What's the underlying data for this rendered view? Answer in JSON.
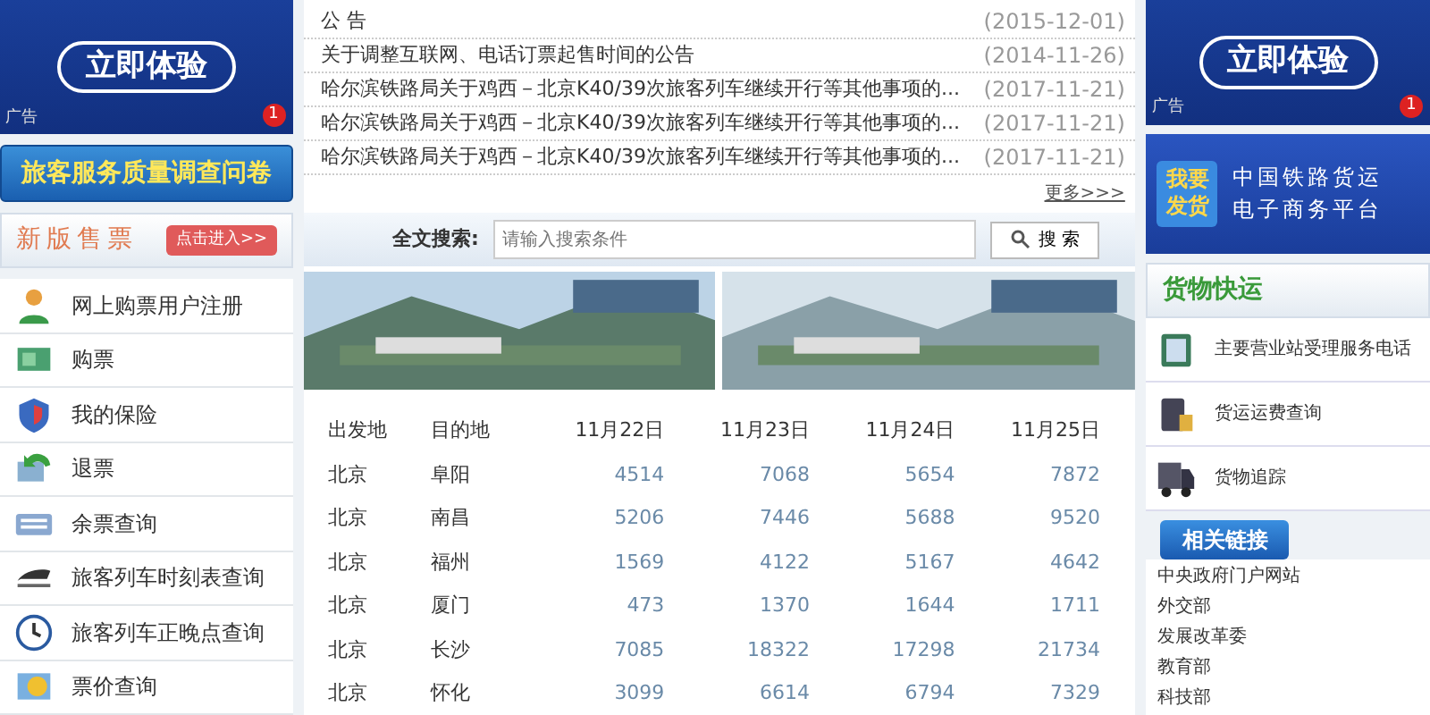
{
  "left_ad": {
    "button": "立即体验",
    "tag": "广告",
    "counter": "1"
  },
  "survey_button": "旅客服务质量调查问卷",
  "new_ticketing": {
    "title": "新版售票",
    "enter_button": "点击进入>>"
  },
  "services": [
    {
      "label": "网上购票用户注册",
      "kind": "user"
    },
    {
      "label": "购票",
      "kind": "ticket"
    },
    {
      "label": "我的保险",
      "kind": "shield"
    },
    {
      "label": "退票",
      "kind": "refund"
    },
    {
      "label": "余票查询",
      "kind": "keyboard"
    },
    {
      "label": "旅客列车时刻表查询",
      "kind": "train"
    },
    {
      "label": "旅客列车正晚点查询",
      "kind": "clock"
    },
    {
      "label": "票价查询",
      "kind": "price"
    }
  ],
  "notices": [
    {
      "title": "公 告",
      "date": "(2015-12-01)"
    },
    {
      "title": "关于调整互联网、电话订票起售时间的公告",
      "date": "(2014-11-26)"
    },
    {
      "title": "哈尔滨铁路局关于鸡西－北京K40/39次旅客列车继续开行等其他事项的...",
      "date": "(2017-11-21)"
    },
    {
      "title": "哈尔滨铁路局关于鸡西－北京K40/39次旅客列车继续开行等其他事项的...",
      "date": "(2017-11-21)"
    },
    {
      "title": "哈尔滨铁路局关于鸡西－北京K40/39次旅客列车继续开行等其他事项的...",
      "date": "(2017-11-21)"
    }
  ],
  "more_link": "更多>>>",
  "search": {
    "label": "全文搜索:",
    "placeholder": "请输入搜索条件",
    "button": "搜 索"
  },
  "table": {
    "columns": [
      "出发地",
      "目的地",
      "11月22日",
      "11月23日",
      "11月24日",
      "11月25日"
    ],
    "rows": [
      [
        "北京",
        "阜阳",
        "4514",
        "7068",
        "5654",
        "7872"
      ],
      [
        "北京",
        "南昌",
        "5206",
        "7446",
        "5688",
        "9520"
      ],
      [
        "北京",
        "福州",
        "1569",
        "4122",
        "5167",
        "4642"
      ],
      [
        "北京",
        "厦门",
        "473",
        "1370",
        "1644",
        "1711"
      ],
      [
        "北京",
        "长沙",
        "7085",
        "18322",
        "17298",
        "21734"
      ],
      [
        "北京",
        "怀化",
        "3099",
        "6614",
        "6794",
        "7329"
      ]
    ]
  },
  "right_ad": {
    "button": "立即体验",
    "tag": "广告",
    "counter": "1"
  },
  "freight_banner": {
    "badge": [
      "我要",
      "发货"
    ],
    "lines": [
      "中国铁路货运",
      "电子商务平台"
    ]
  },
  "freight": {
    "title": "货物快运",
    "items": [
      {
        "label": "主要营业站受理服务电话",
        "kind": "phone"
      },
      {
        "label": "货运运费查询",
        "kind": "calculator"
      },
      {
        "label": "货物追踪",
        "kind": "truck"
      }
    ]
  },
  "links": {
    "title": "相关链接",
    "items": [
      "中央政府门户网站",
      "外交部",
      "发展改革委",
      "教育部",
      "科技部"
    ]
  }
}
